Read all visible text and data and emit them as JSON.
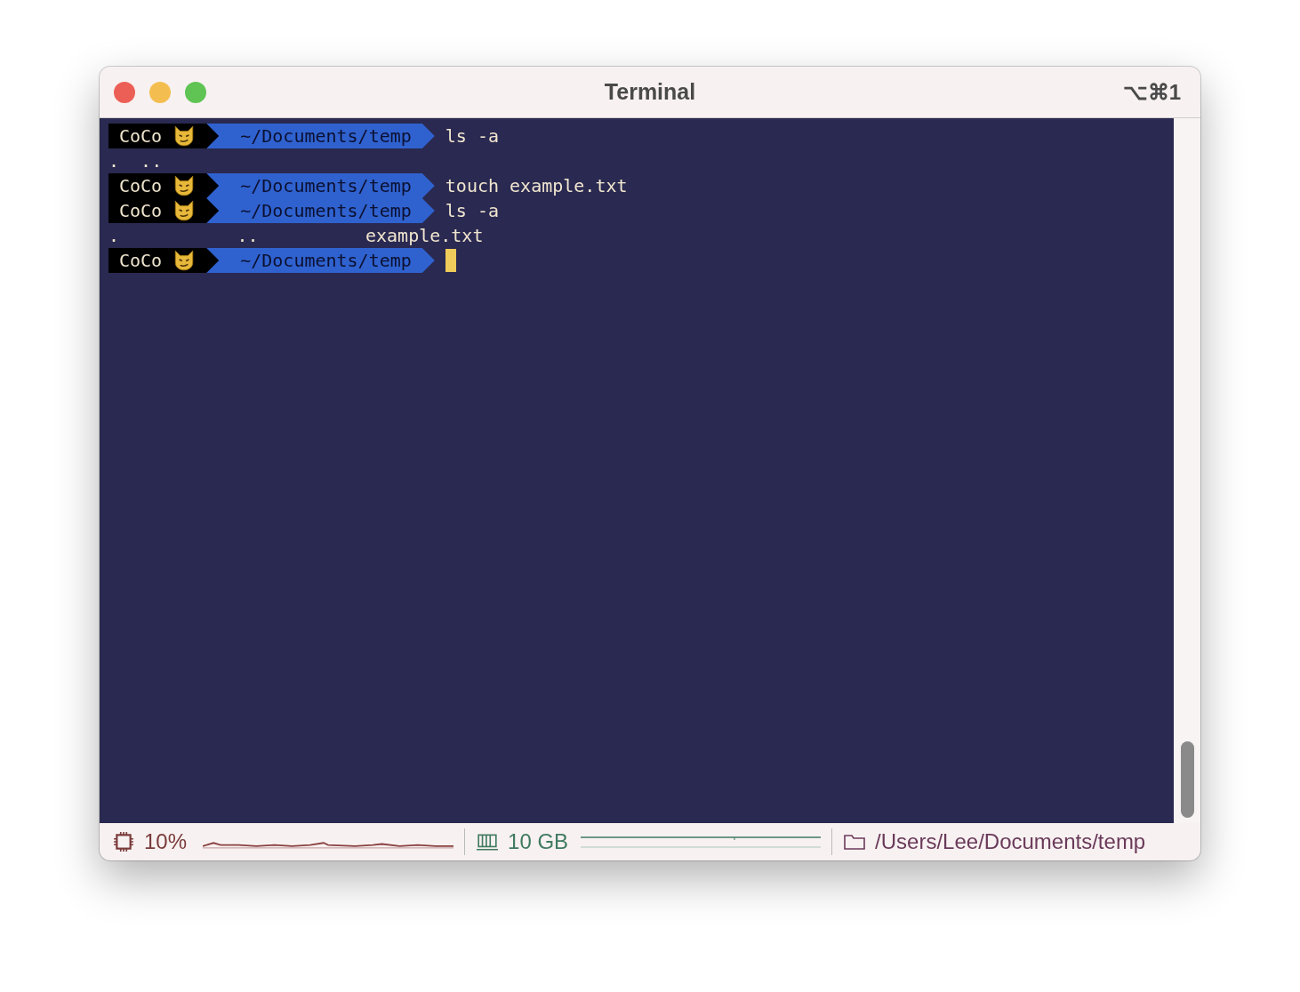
{
  "window": {
    "title": "Terminal",
    "shortcut": "⌥⌘1"
  },
  "lines": [
    {
      "kind": "prompt",
      "user": "CoCo",
      "path": "~/Documents/temp",
      "command": "ls -a",
      "cursor": false
    },
    {
      "kind": "output",
      "text": ".  .."
    },
    {
      "kind": "prompt",
      "user": "CoCo",
      "path": "~/Documents/temp",
      "command": "touch example.txt",
      "cursor": false
    },
    {
      "kind": "prompt",
      "user": "CoCo",
      "path": "~/Documents/temp",
      "command": "ls -a",
      "cursor": false
    },
    {
      "kind": "output",
      "text": ".           ..          example.txt"
    },
    {
      "kind": "prompt",
      "user": "CoCo",
      "path": "~/Documents/temp",
      "cursor": true
    }
  ],
  "status_bar": {
    "cpu": "10%",
    "memory": "10 GB",
    "path": "/Users/Lee/Documents/temp"
  }
}
